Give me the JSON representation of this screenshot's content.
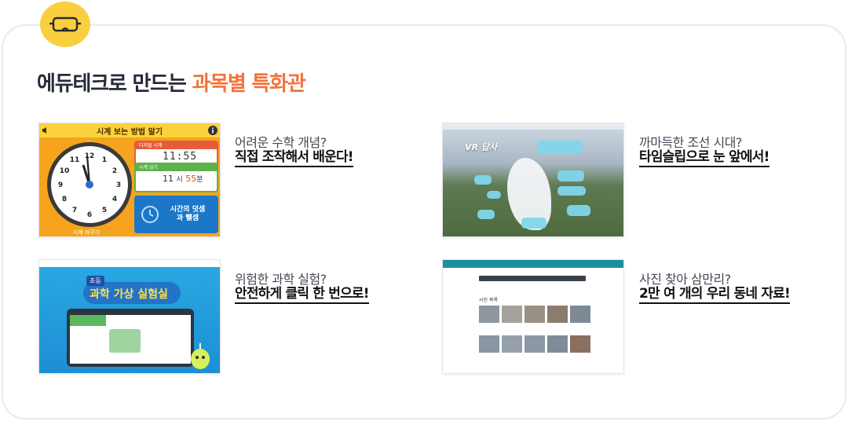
{
  "heading": {
    "prefix": "에듀테크로 만드는",
    "accent": "과목별 특화관"
  },
  "colors": {
    "accent": "#f1743a",
    "badge": "#f9cf3f",
    "border": "#e9e9ec"
  },
  "badge_icon": "vr-goggles-icon",
  "cards": [
    {
      "question": "어려운 수학 개념?",
      "answer": "직접 조작해서 배운다!",
      "thumb": {
        "title": "시계 보는 방법 알기",
        "digital_label": "디지털 시계",
        "digital_time": "11:55",
        "read_label": "시계 읽기",
        "read_hour": "11",
        "read_hour_unit": "시",
        "read_min": "55",
        "read_min_unit": "분",
        "blue_text": "시간의 덧셈과 뺄셈",
        "footer": "시계 바꾸기",
        "clock_numbers": [
          "12",
          "1",
          "2",
          "3",
          "4",
          "5",
          "6",
          "7",
          "8",
          "9",
          "10",
          "11"
        ]
      }
    },
    {
      "question": "까마득한 조선 시대?",
      "answer": "타임슬립으로 눈 앞에서!",
      "thumb": {
        "title": "VR 답사"
      }
    },
    {
      "question": "위험한 과학 실험?",
      "answer": "안전하게 클릭 한 번으로!",
      "thumb": {
        "grade": "초등",
        "title": "과학 가상 실험실"
      }
    },
    {
      "question": "사진 찾아 삼만리?",
      "answer": "2만 여 개의 우리 동네 자료!",
      "thumb": {
        "section": "사진 목록"
      }
    }
  ]
}
